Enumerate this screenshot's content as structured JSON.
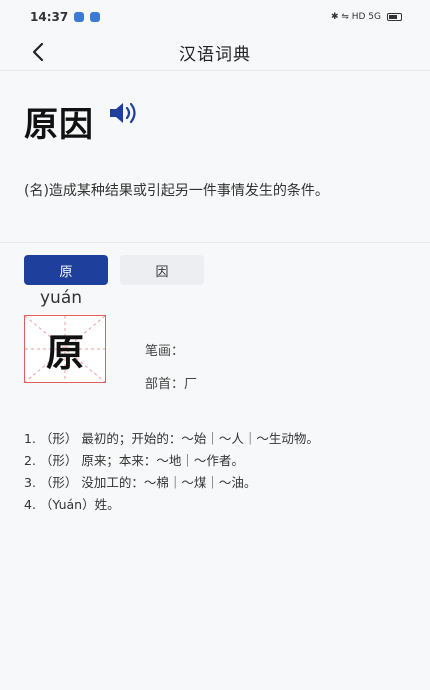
{
  "status_bar": {
    "time": "14:37",
    "right_text": "✱ ⇋ HD 5G"
  },
  "header": {
    "title": "汉语词典"
  },
  "word": {
    "text": "原因",
    "definition": "(名)造成某种结果或引起另一件事情发生的条件。"
  },
  "tabs": [
    {
      "label": "原",
      "active": true
    },
    {
      "label": "因",
      "active": false
    }
  ],
  "character": {
    "glyph": "原",
    "pinyin": "yuán",
    "strokes_label": "笔画：",
    "radical_label": "部首：厂"
  },
  "meanings": [
    "1. （形） 最初的；开始的：～始｜～人｜～生动物。",
    "2. （形） 原来；本来：～地｜～作者。",
    "3. （形） 没加工的：～棉｜～煤｜～油。",
    "4. （Yuán）姓。"
  ],
  "colors": {
    "accent": "#1f3f9c",
    "speaker": "#1f3f9c",
    "grid_line": "#e06060"
  }
}
